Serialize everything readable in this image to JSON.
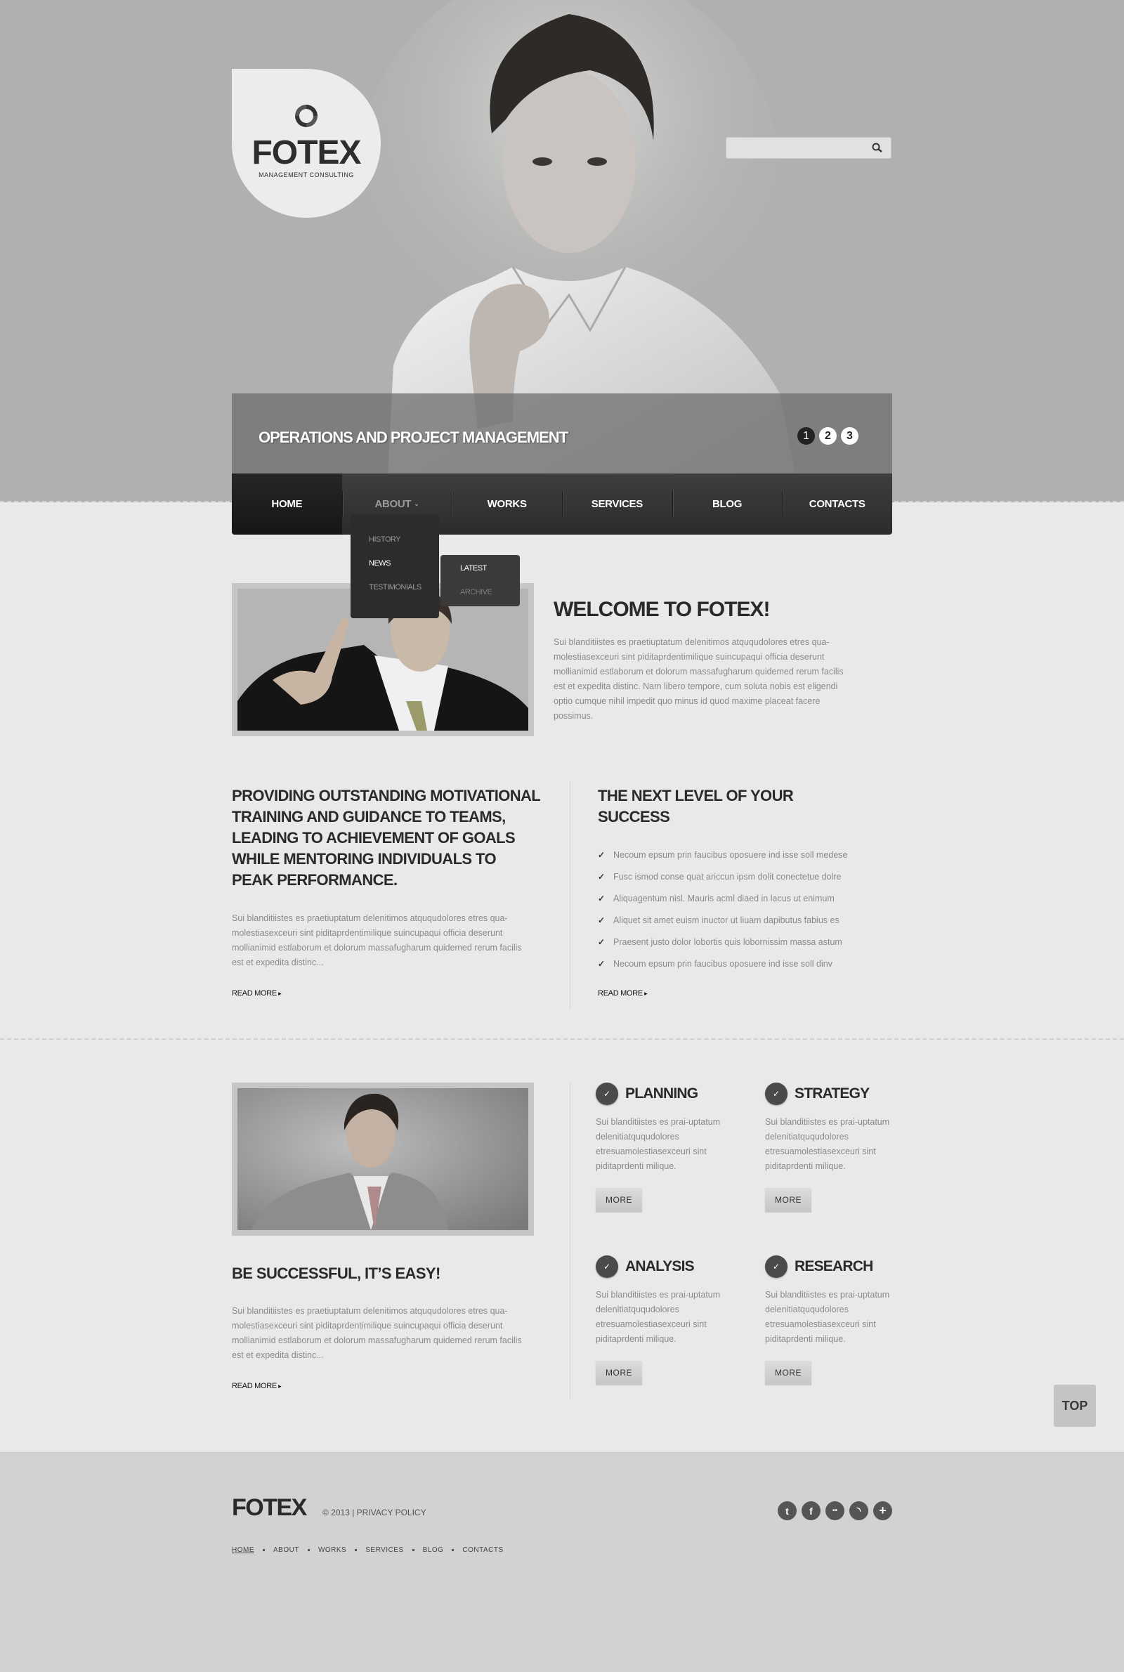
{
  "brand": {
    "name": "FOTEX",
    "tagline": "MANAGEMENT CONSULTING"
  },
  "search": {
    "placeholder": "",
    "value": "",
    "icon": "search-icon"
  },
  "slider": {
    "caption": "OPERATIONS AND PROJECT MANAGEMENT",
    "pages": [
      "1",
      "2",
      "3"
    ],
    "active_page": "1"
  },
  "nav": {
    "items": [
      {
        "label": "HOME",
        "active": true
      },
      {
        "label": "ABOUT",
        "has_dropdown": true,
        "open": true
      },
      {
        "label": "WORKS"
      },
      {
        "label": "SERVICES"
      },
      {
        "label": "BLOG"
      },
      {
        "label": "CONTACTS"
      }
    ],
    "about_dropdown": [
      "HISTORY",
      "NEWS",
      "TESTIMONIALS"
    ],
    "news_submenu": [
      "LATEST",
      "ARCHIVE"
    ]
  },
  "welcome": {
    "title": "WELCOME TO FOTEX!",
    "text": "Sui blanditiistes es praetiuptatum delenitimos atququdolores etres qua-molestiasexceuri sint piditaprdentimilique suincupaqui officia deserunt mollianimid estlaborum et dolorum massafugharum quidemed rerum facilis est et expedita distinc. Nam libero tempore, cum soluta nobis est eligendi optio cumque nihil impedit quo minus id quod maxime placeat facere possimus."
  },
  "motivation": {
    "title": "PROVIDING OUTSTANDING MOTIVATIONAL TRAINING AND GUIDANCE TO TEAMS, LEADING TO ACHIEVEMENT OF GOALS WHILE MENTORING INDIVIDUALS TO PEAK PERFORMANCE.",
    "text": "Sui blanditiistes es praetiuptatum delenitimos atququdolores etres qua-molestiasexceuri sint piditaprdentimilique suincupaqui officia deserunt mollianimid estlaborum et dolorum massafugharum quidemed rerum facilis est et expedita distinc...",
    "read_more": "READ MORE"
  },
  "next_level": {
    "title": "THE NEXT LEVEL OF YOUR SUCCESS",
    "items": [
      "Necoum epsum prin faucibus oposuere ind isse soll medese",
      "Fusc ismod conse quat ariccun ipsm dolit conectetue dolre",
      "Aliquagentum nisl. Mauris acml diaed in lacus ut enimum",
      "Aliquet sit amet euism inuctor ut liuam dapibutus fabius es",
      "Praesent justo dolor lobortis quis lobornissim massa astum",
      "Necoum epsum prin faucibus oposuere ind isse soll dinv"
    ],
    "read_more": "READ MORE"
  },
  "easy": {
    "title": "BE SUCCESSFUL, IT’S EASY!",
    "text": "Sui blanditiistes es praetiuptatum delenitimos atququdolores etres qua-molestiasexceuri sint piditaprdentimilique suincupaqui officia deserunt mollianimid estlaborum et dolorum massafugharum quidemed rerum facilis est et expedita distinc...",
    "read_more": "READ MORE"
  },
  "services": [
    {
      "title": "PLANNING",
      "text": "Sui blanditiistes es prai-uptatum delenitiatququdolores etresuamolestiasexceuri sint piditaprdenti milique.",
      "button": "MORE"
    },
    {
      "title": "STRATEGY",
      "text": "Sui blanditiistes es prai-uptatum delenitiatququdolores etresuamolestiasexceuri sint piditaprdenti milique.",
      "button": "MORE"
    },
    {
      "title": "ANALYSIS",
      "text": "Sui blanditiistes es prai-uptatum delenitiatququdolores etresuamolestiasexceuri sint piditaprdenti milique.",
      "button": "MORE"
    },
    {
      "title": "RESEARCH",
      "text": "Sui blanditiistes es prai-uptatum delenitiatququdolores etresuamolestiasexceuri sint piditaprdenti milique.",
      "button": "MORE"
    }
  ],
  "top_button": "TOP",
  "footer": {
    "logo": "FOTEX",
    "copyright": "© 2013 |",
    "privacy": "PRIVACY POLICY",
    "nav": [
      "HOME",
      "ABOUT",
      "WORKS",
      "SERVICES",
      "BLOG",
      "CONTACTS"
    ],
    "social": [
      {
        "name": "twitter-icon",
        "glyph": "t"
      },
      {
        "name": "facebook-icon",
        "glyph": "f"
      },
      {
        "name": "flickr-icon",
        "glyph": "••"
      },
      {
        "name": "rss-icon",
        "glyph": "◝"
      },
      {
        "name": "plus-icon",
        "glyph": "+"
      }
    ]
  },
  "colors": {
    "header_bg": "#b0b0af",
    "page_bg": "#e9e9e9",
    "nav_bg": "#333333",
    "text_dark": "#2a2a2a",
    "text_muted": "#8a8a8a",
    "footer_bg": "#d2d2d2"
  }
}
